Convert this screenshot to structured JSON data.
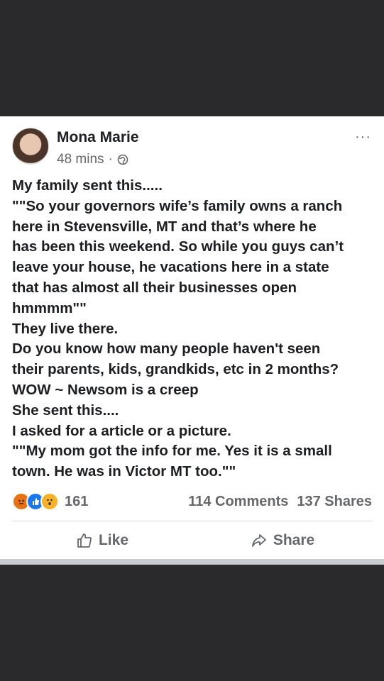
{
  "post": {
    "author": "Mona Marie",
    "time": "48 mins",
    "separator": "·",
    "more_icon": "···",
    "lines": [
      "My family sent this.....",
      "\"\"So your governors wife’s family owns a ranch",
      "here in Stevensville, MT and that’s where he",
      "has been this weekend. So while you guys can’t",
      "leave your house, he vacations here in a state",
      "that has almost all their businesses open",
      "hmmmm\"\"",
      "They live there.",
      "Do you know how many people haven't seen",
      "their parents, kids, grandkids, etc in 2 months?",
      "WOW ~ Newsom is a creep",
      "She sent this....",
      "I asked for a article or a picture.",
      "\"\"My mom got the info for me. Yes it is a small",
      "town. He was in Victor MT too.\"\""
    ]
  },
  "stats": {
    "reaction_count": "161",
    "comments": "114 Comments",
    "shares": "137 Shares",
    "reaction_icons": [
      "angry",
      "like",
      "wow"
    ]
  },
  "actions": {
    "like_label": "Like",
    "share_label": "Share"
  }
}
